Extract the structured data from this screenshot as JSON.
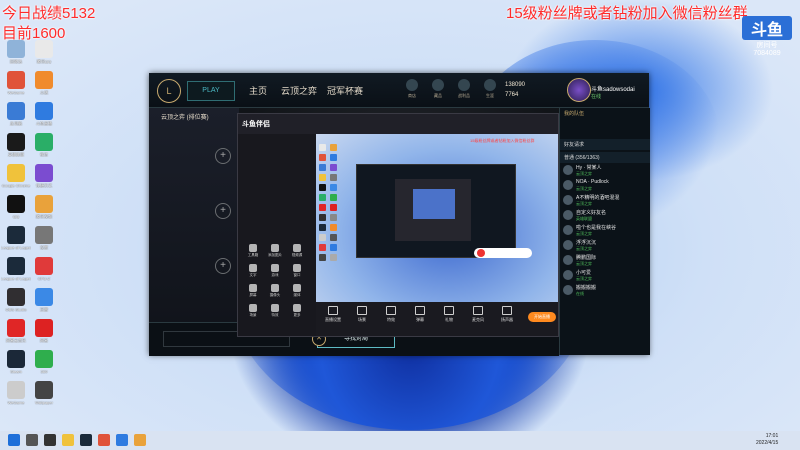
{
  "overlay": {
    "line1": "今日战绩5132",
    "line2": "目前1600",
    "banner": "15级粉丝牌或者钻粉加入微信粉丝群"
  },
  "watermark": {
    "logo": "斗鱼",
    "sub": "房间号",
    "room": "7084089"
  },
  "desktop_icons": [
    {
      "label": "回收站",
      "color": "#8fb3d9"
    },
    {
      "label": "WeGame",
      "color": "#e0533a"
    },
    {
      "label": "此电脑",
      "color": "#3a7bd5"
    },
    {
      "label": "英雄联盟",
      "color": "#1a1a1a"
    },
    {
      "label": "Google Chrome",
      "color": "#f0c23b"
    },
    {
      "label": "QQ",
      "color": "#111111"
    },
    {
      "label": "League of Legends",
      "color": "#1b2a3a"
    },
    {
      "label": "League of Legends",
      "color": "#1b2a3a"
    },
    {
      "label": "OBS Studio",
      "color": "#302e31"
    },
    {
      "label": "网易云音乐",
      "color": "#e02626"
    },
    {
      "label": "Steam",
      "color": "#1b2838"
    },
    {
      "label": "WeGame",
      "color": "#cccccc"
    }
  ],
  "desktop_icons_col2": [
    {
      "label": "腾讯QQ",
      "color": "#e9e9e9"
    },
    {
      "label": "火绒",
      "color": "#f08b2d"
    },
    {
      "label": "斗鱼直播",
      "color": "#2f7be0"
    },
    {
      "label": "微信",
      "color": "#2aae67"
    },
    {
      "label": "快捷方式",
      "color": "#7b4cd0"
    },
    {
      "label": "腾讯视频",
      "color": "#e9a23b"
    },
    {
      "label": "设置",
      "color": "#777777"
    },
    {
      "label": "CPU-Z",
      "color": "#e03a3a"
    },
    {
      "label": "迅雷",
      "color": "#3b89e6"
    },
    {
      "label": "网易",
      "color": "#d22"
    },
    {
      "label": "360",
      "color": "#2fae4d"
    },
    {
      "label": "Wallpaper",
      "color": "#444"
    }
  ],
  "client": {
    "logo": "L",
    "play_button": "PLAY",
    "nav": [
      "主页",
      "云顶之弈",
      "冠军杯赛"
    ],
    "mini_icons": [
      "商店",
      "藏品",
      "战利品",
      "生涯"
    ],
    "currency_be": "138090",
    "currency_rp": "7764",
    "username": "斗鱼sadowsodai",
    "user_status": "在线",
    "queue_title": "云顶之弈 (排位赛)",
    "find_match": "寻找对局",
    "right_panel": {
      "header": "我的队伍",
      "section_1": "好友请求",
      "section_2": "普通 (356/1363)",
      "friends": [
        {
          "name": "Hy · 常某人",
          "status": "云顶之弈"
        },
        {
          "name": "NOA · Pudlock",
          "status": "云顶之弈"
        },
        {
          "name": "A不精明的酒吧混混",
          "status": "云顶之弈"
        },
        {
          "name": "自定义好友名",
          "status": "英雄联盟"
        },
        {
          "name": "啦个也是我在峡谷",
          "status": "云顶之弈"
        },
        {
          "name": "浮浮沉沉",
          "status": "云顶之弈"
        },
        {
          "name": "腾鹏国际",
          "status": "云顶之弈"
        },
        {
          "name": "小可爱",
          "status": "云顶之弈"
        },
        {
          "name": "搬搬搬搬",
          "status": "在线"
        }
      ]
    }
  },
  "streamer": {
    "logo": "斗鱼伴侣",
    "tools": [
      "工具箱",
      "添加图片",
      "视频源",
      "文字",
      "游戏",
      "窗口",
      "屏幕",
      "摄像头",
      "媒体",
      "场景",
      "特效",
      "更多"
    ],
    "preview_banner": "15级粉丝牌或者钻粉加入微信粉丝群",
    "controls": [
      "直播设置",
      "场景",
      "特效",
      "弹幕",
      "礼物",
      "麦克风",
      "扬声器"
    ],
    "go_live": "开始直播"
  },
  "taskbar": {
    "time": "17:01",
    "date": "2022/4/15"
  }
}
